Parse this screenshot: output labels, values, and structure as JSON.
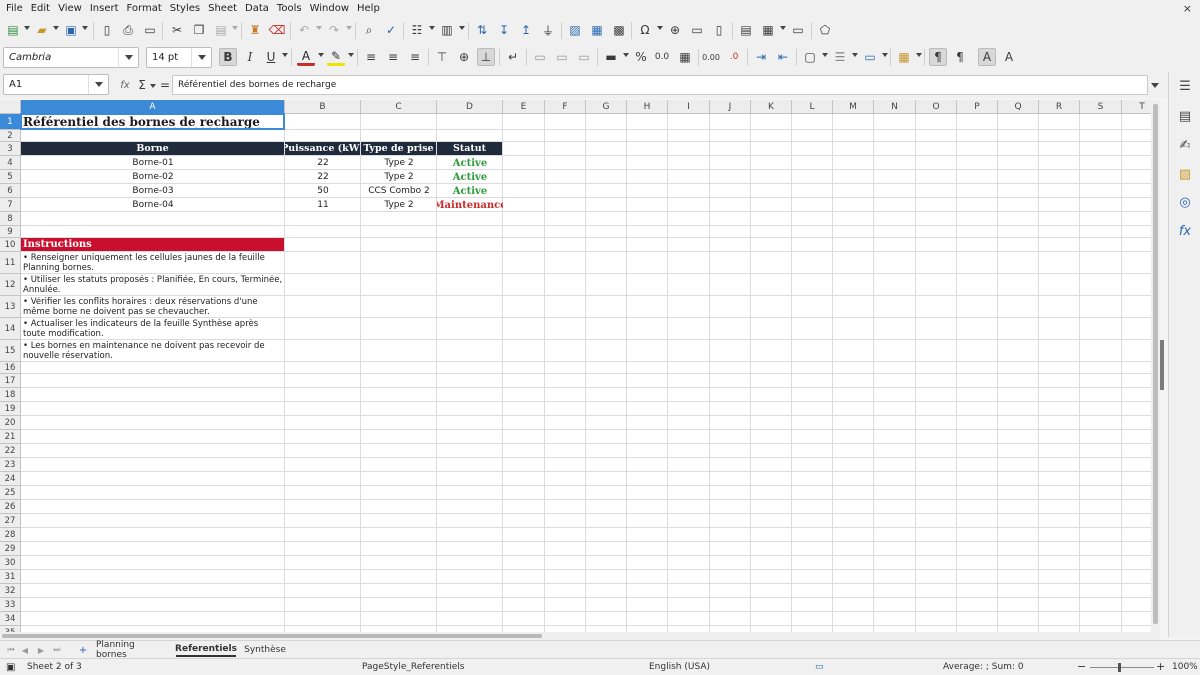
{
  "menu": [
    "File",
    "Edit",
    "View",
    "Insert",
    "Format",
    "Styles",
    "Sheet",
    "Data",
    "Tools",
    "Window",
    "Help"
  ],
  "window": {
    "close_glyph": "×"
  },
  "toolbar": {
    "font_name": "Cambria",
    "font_size": "14 pt",
    "bold": "B",
    "italic": "I",
    "underline": "U",
    "font_color_glyph": "A",
    "percent": "%",
    "decimals": "0.0",
    "add_decimal": "0.00",
    "remove_decimal": ".0"
  },
  "formula_bar": {
    "name_box": "A1",
    "fx": "fx",
    "sum": "Σ",
    "equals": "=",
    "content": "Référentiel des bornes de recharge"
  },
  "columns": [
    "A",
    "B",
    "C",
    "D",
    "E",
    "F",
    "G",
    "H",
    "I",
    "J",
    "K",
    "L",
    "M",
    "N",
    "O",
    "P",
    "Q",
    "R",
    "S",
    "T"
  ],
  "rows": [
    "1",
    "2",
    "3",
    "4",
    "5",
    "6",
    "7",
    "8",
    "9",
    "10",
    "11",
    "12",
    "13",
    "14",
    "15",
    "16",
    "17",
    "18",
    "19",
    "20",
    "21",
    "22",
    "23",
    "24",
    "25",
    "26",
    "27",
    "28",
    "29",
    "30",
    "31",
    "32",
    "33",
    "34",
    "35"
  ],
  "sheet": {
    "title": "Référentiel des bornes de recharge",
    "table_headers": [
      "Borne",
      "Puissance (kW)",
      "Type de prise",
      "Statut"
    ],
    "table_rows": [
      {
        "borne": "Borne-01",
        "puissance": "22",
        "prise": "Type 2",
        "statut": "Active"
      },
      {
        "borne": "Borne-02",
        "puissance": "22",
        "prise": "Type 2",
        "statut": "Active"
      },
      {
        "borne": "Borne-03",
        "puissance": "50",
        "prise": "CCS Combo 2",
        "statut": "Active"
      },
      {
        "borne": "Borne-04",
        "puissance": "11",
        "prise": "Type 2",
        "statut": "Maintenance"
      }
    ],
    "status_colors": {
      "Active": "#2e9a3a",
      "Maintenance": "#cc2a2a"
    },
    "instructions_title": "Instructions",
    "instructions": [
      "• Renseigner uniquement les cellules jaunes de la feuille Planning bornes.",
      "• Utiliser les statuts proposés : Planifiée, En cours, Terminée, Annulée.",
      "• Vérifier les conflits horaires : deux réservations d'une même borne ne doivent pas se chevaucher.",
      "• Actualiser les indicateurs de la feuille Synthèse après toute modification.",
      "• Les bornes en maintenance ne doivent pas recevoir de nouvelle réservation."
    ]
  },
  "tabs": {
    "items": [
      "Planning bornes",
      "Referentiels",
      "Synthèse"
    ],
    "active": "Referentiels",
    "add_glyph": "+"
  },
  "statusbar": {
    "sheet_pos": "Sheet 2 of 3",
    "page_style": "PageStyle_Referentiels",
    "language": "English (USA)",
    "summary": "Average: ; Sum: 0",
    "zoom_minus": "−",
    "zoom_plus": "+",
    "zoom": "100%"
  },
  "colors": {
    "header_dark": "#1f2a3c",
    "instructions_red": "#c8102e",
    "selection": "#3b8ad8"
  }
}
